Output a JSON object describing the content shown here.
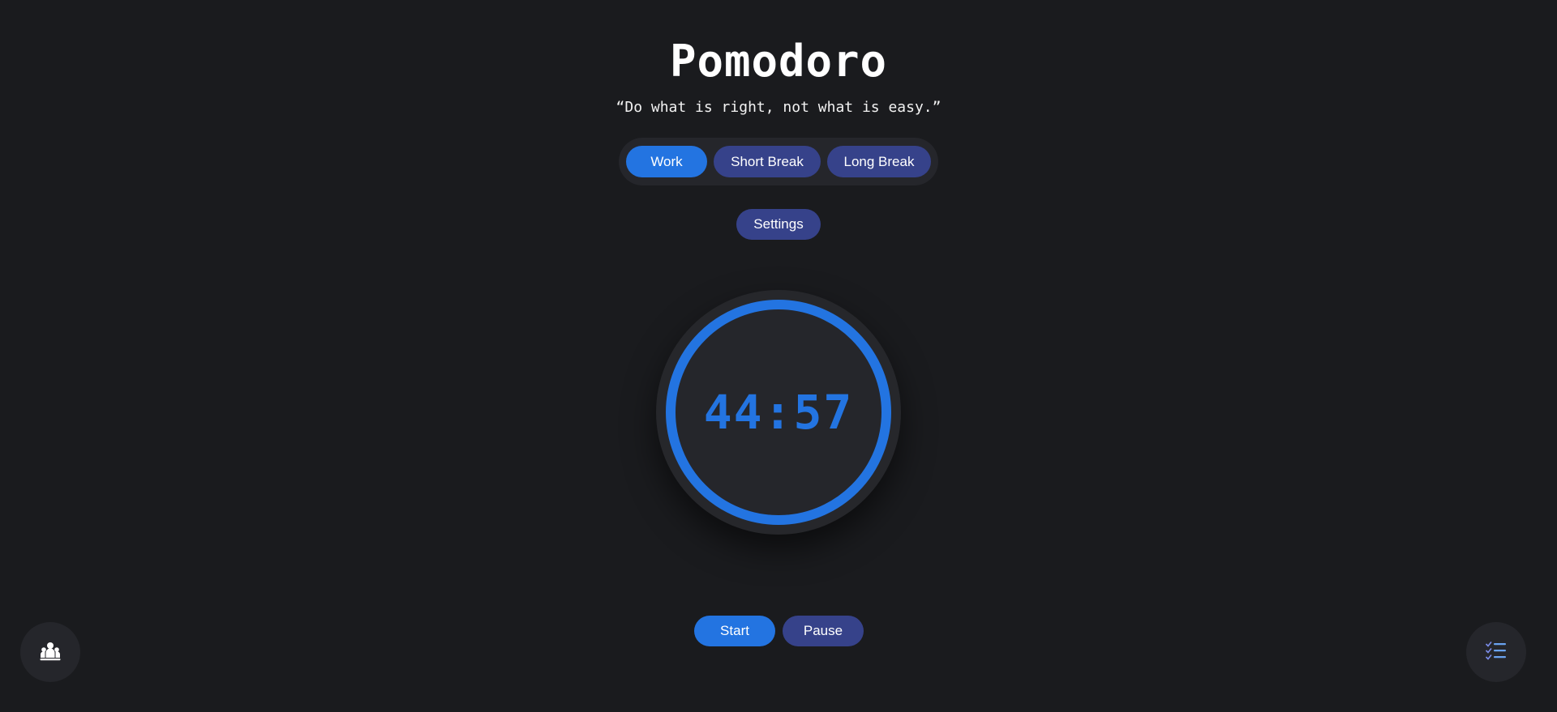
{
  "app": {
    "title": "Pomodoro",
    "quote": "“Do what is right, not what is easy.”"
  },
  "modes": {
    "work_label": "Work",
    "short_break_label": "Short Break",
    "long_break_label": "Long Break",
    "active": "Work"
  },
  "settings": {
    "label": "Settings"
  },
  "timer": {
    "display": "44:57"
  },
  "controls": {
    "start_label": "Start",
    "pause_label": "Pause"
  },
  "fabs": {
    "left_icon": "people-group-icon",
    "right_icon": "checklist-icon"
  },
  "colors": {
    "background": "#1a1b1e",
    "accent": "#2374e1",
    "secondary": "#36428a",
    "surface": "#25262b"
  }
}
